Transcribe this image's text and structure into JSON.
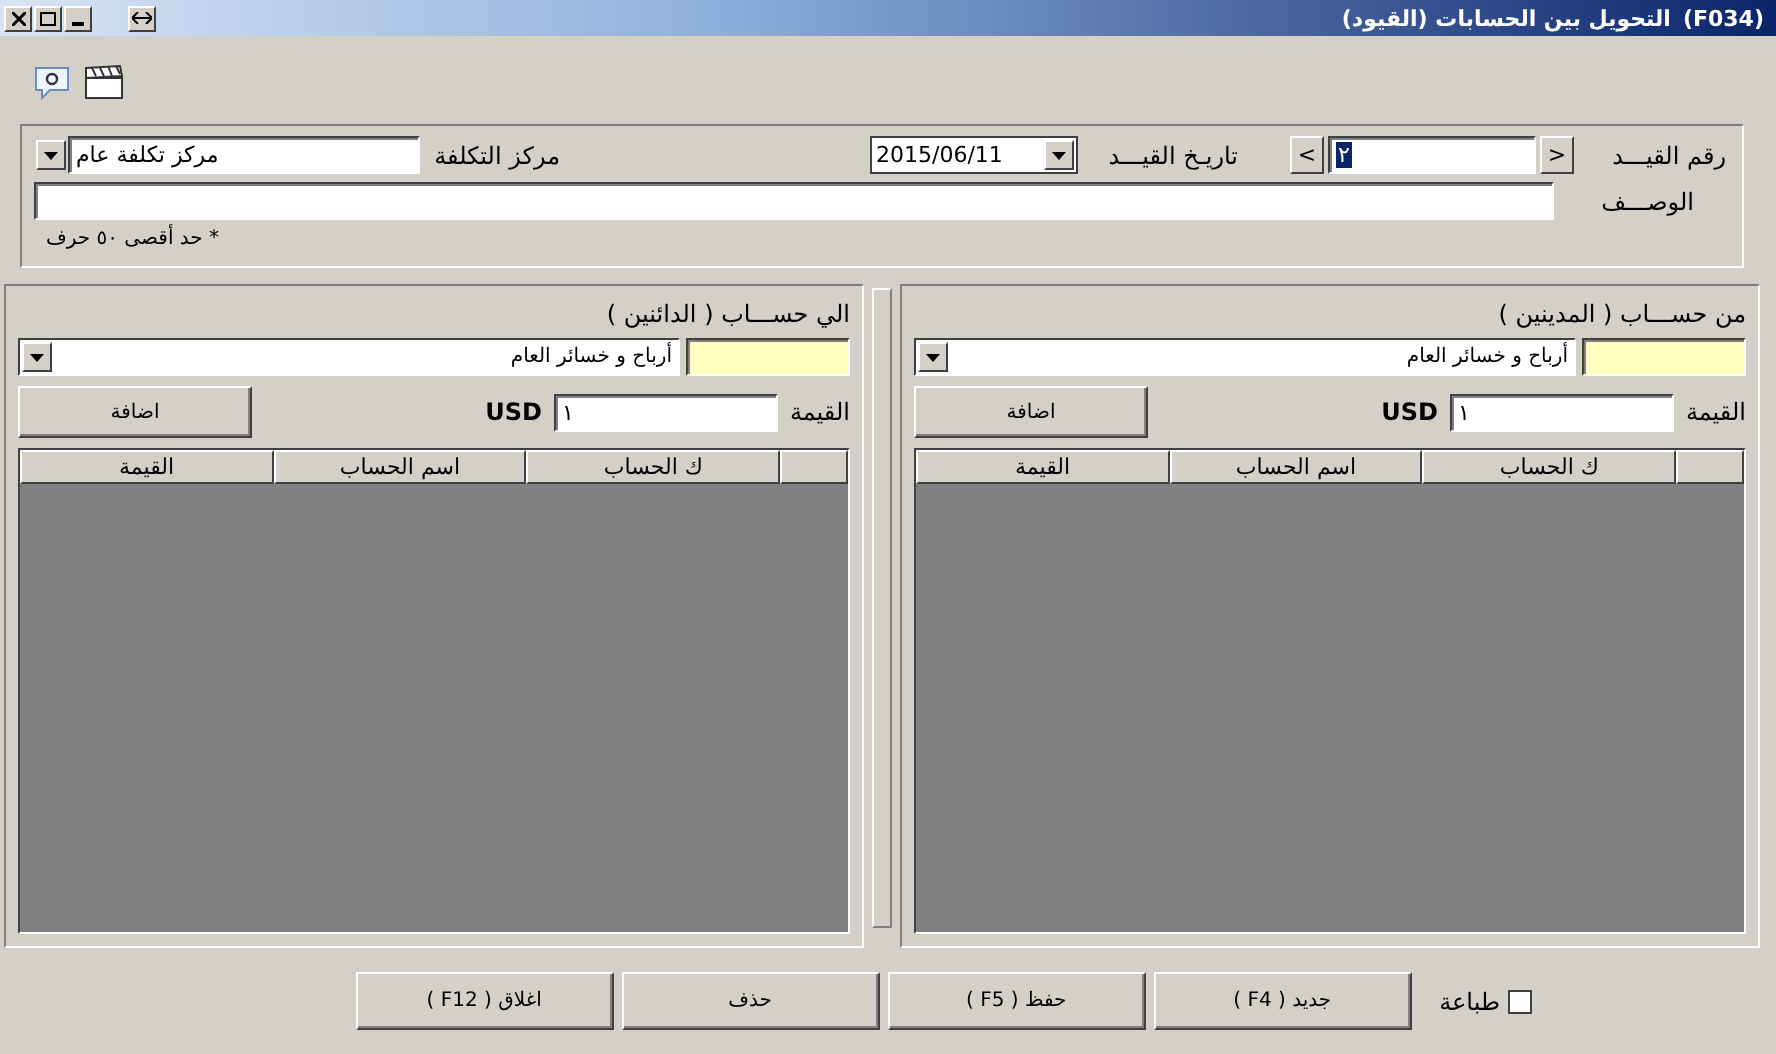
{
  "window": {
    "code": "(F034)",
    "title": "التحويل بين الحسابات (القيود)"
  },
  "header": {
    "entry_label": "رقم القيـــد",
    "entry_value": "٢",
    "entry_selected": true,
    "prev": "<",
    "next": ">",
    "date_label": "تاريـخ القيـــد",
    "date_value": "2015/06/11",
    "cost_label": "مركز التكلفة",
    "cost_value": "مركز تكلفة عام",
    "desc_label": "الوصـــف",
    "desc_hint": "* حد أقصى ٥٠ حرف"
  },
  "panels": [
    {
      "title": "من حســـاب ( المدينين )",
      "account_name": "أرباح و خسائر العام",
      "amount_label": "القيمة",
      "amount": "١",
      "currency": "USD",
      "add": "اضافة",
      "columns": [
        "ك الحساب",
        "اسم الحساب",
        "القيمة"
      ]
    },
    {
      "title": "الي حســـاب ( الدائنين )",
      "account_name": "أرباح و خسائر العام",
      "amount_label": "القيمة",
      "amount": "١",
      "currency": "USD",
      "add": "اضافة",
      "columns": [
        "ك الحساب",
        "اسم الحساب",
        "القيمة"
      ]
    }
  ],
  "footer": {
    "print": {
      "label": "طباعة",
      "checked": false
    },
    "buttons": [
      "جديد ( F4 )",
      "حفظ ( F5 )",
      "حذف",
      "اغلاق ( F12 )"
    ]
  }
}
